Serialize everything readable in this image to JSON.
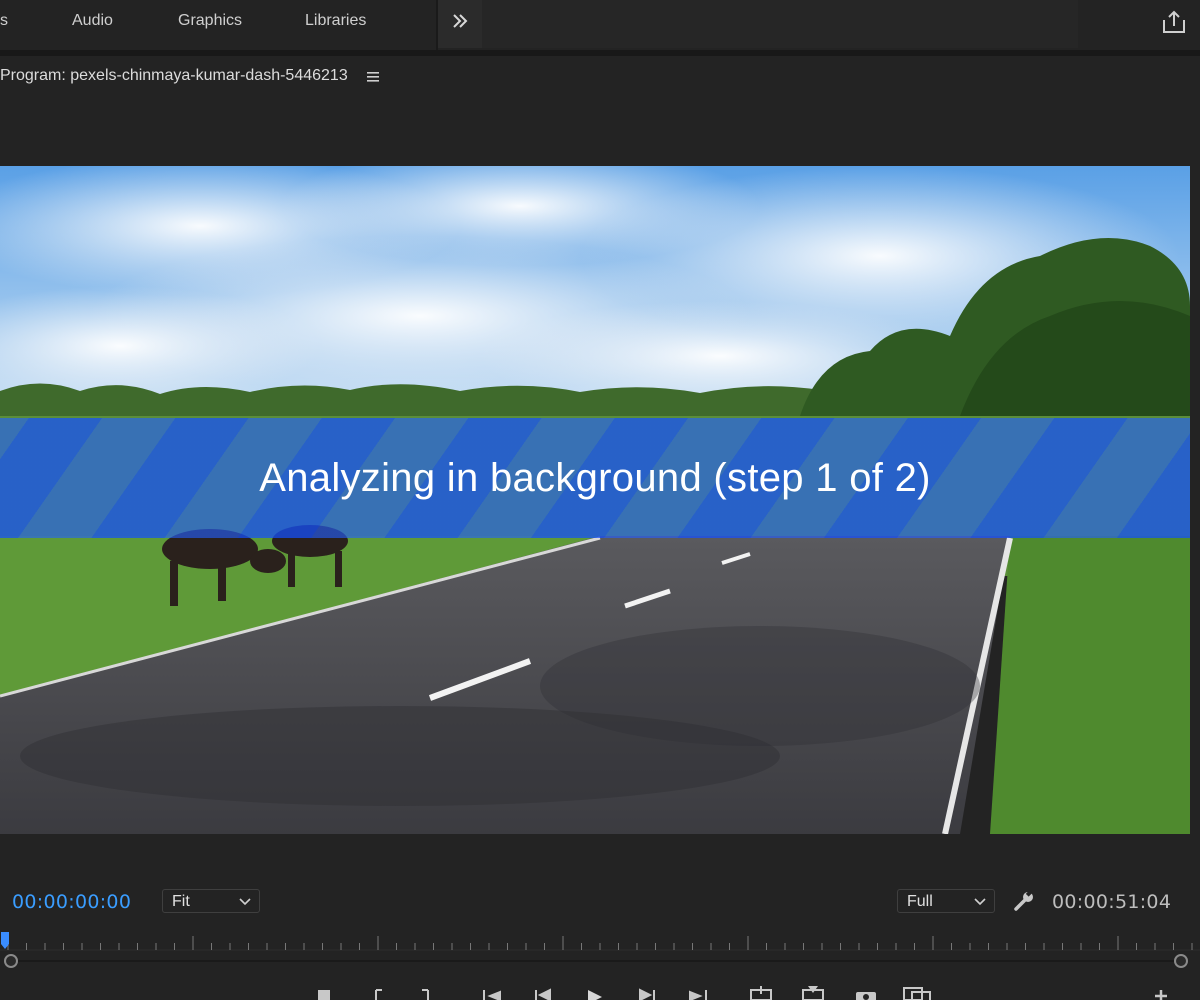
{
  "workspace_tabs": [
    {
      "label": "s"
    },
    {
      "label": "Audio"
    },
    {
      "label": "Graphics"
    },
    {
      "label": "Libraries"
    }
  ],
  "panel": {
    "title": "Program: pexels-chinmaya-kumar-dash-5446213"
  },
  "overlay": {
    "message": "Analyzing in background (step 1 of 2)"
  },
  "controls": {
    "current_time": "00:00:00:00",
    "zoom_value": "Fit",
    "resolution_value": "Full",
    "duration": "00:00:51:04"
  },
  "colors": {
    "accent_timecode": "#3a9dff",
    "overlay_blue": "#1450ff",
    "panel_bg": "#232323"
  },
  "icons": {
    "overflow": "chevron-double-right-icon",
    "share": "share-export-icon",
    "panel_menu": "hamburger-menu-icon",
    "settings": "wrench-icon"
  }
}
